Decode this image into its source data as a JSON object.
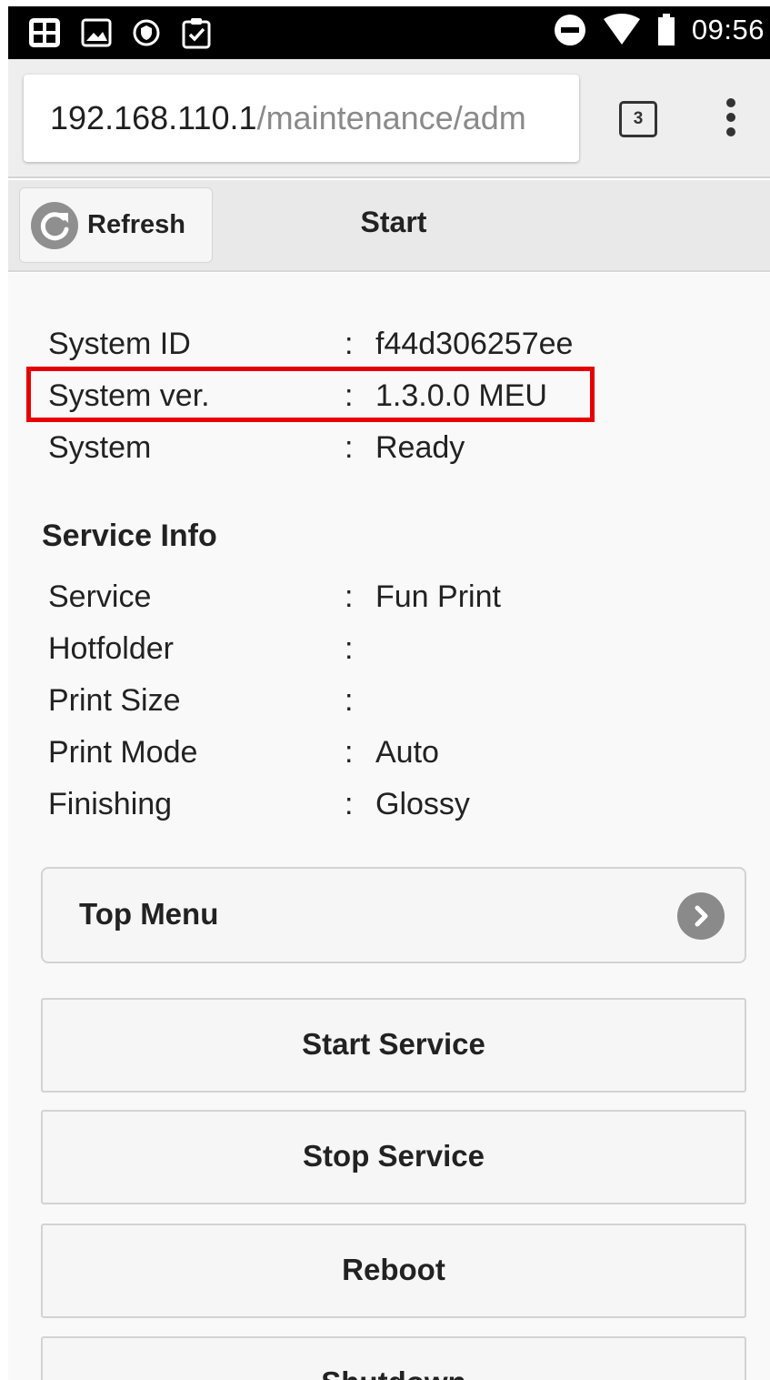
{
  "status_bar": {
    "icons": [
      "keyboard-grid-icon",
      "image-icon",
      "shield-icon",
      "clipboard-check-icon"
    ],
    "right_icons": [
      "do-not-disturb-icon",
      "wifi-icon",
      "battery-icon"
    ],
    "time": "09:56"
  },
  "browser": {
    "url_host": "192.168.110.1",
    "url_path": "/maintenance/adm",
    "tab_count": "3"
  },
  "header": {
    "refresh_label": "Refresh",
    "title": "Start"
  },
  "system_info": [
    {
      "label": "System ID",
      "sep": ":",
      "value": "f44d306257ee"
    },
    {
      "label": "System ver.",
      "sep": ":",
      "value": "1.3.0.0 MEU"
    },
    {
      "label": "System",
      "sep": ":",
      "value": "Ready"
    }
  ],
  "service_info": {
    "title": "Service Info",
    "rows": [
      {
        "label": "Service",
        "sep": ":",
        "value": "Fun Print"
      },
      {
        "label": "Hotfolder",
        "sep": ":",
        "value": ""
      },
      {
        "label": "Print Size",
        "sep": ":",
        "value": ""
      },
      {
        "label": "Print Mode",
        "sep": ":",
        "value": "Auto"
      },
      {
        "label": "Finishing",
        "sep": ":",
        "value": "Glossy"
      }
    ]
  },
  "top_menu": {
    "label": "Top Menu"
  },
  "actions": {
    "start_service": "Start Service",
    "stop_service": "Stop Service",
    "reboot": "Reboot",
    "shutdown": "Shutdown"
  },
  "colors": {
    "highlight": "#e60000",
    "header_bg": "#e9e9e9",
    "content_bg": "#f9f9f9"
  }
}
